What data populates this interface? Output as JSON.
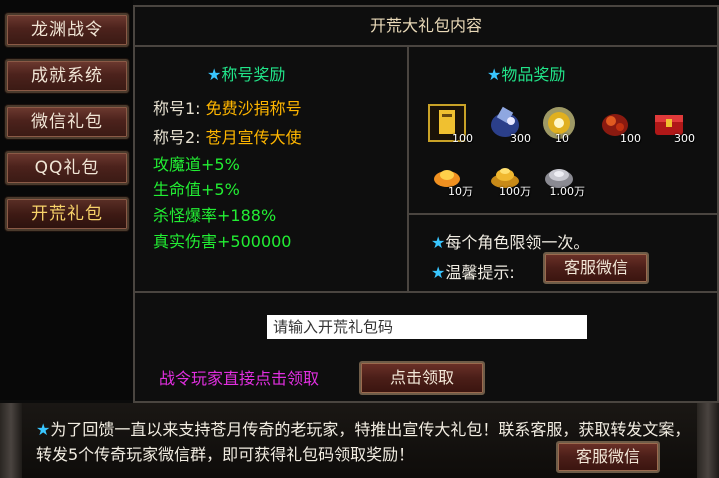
{
  "sidebar": {
    "tabs": [
      {
        "label": "龙渊战令"
      },
      {
        "label": "成就系统"
      },
      {
        "label": "微信礼包"
      },
      {
        "label": "QQ礼包"
      },
      {
        "label": "开荒礼包"
      }
    ],
    "active_index": 4
  },
  "panel": {
    "title": "开荒大礼包内容",
    "title_reward": {
      "heading": "称号奖励",
      "lines": [
        {
          "key": "称号1:",
          "value": "免费沙捐称号"
        },
        {
          "key": "称号2:",
          "value": "苍月宣传大使"
        }
      ],
      "stats": [
        "攻魔道+5%",
        "生命值+5%",
        "杀怪爆率+188%",
        "真实伤害+500000"
      ]
    },
    "item_reward": {
      "heading": "物品奖励",
      "items": [
        {
          "icon": "gold-scroll-icon",
          "qty": "100"
        },
        {
          "icon": "blue-bottle-icon",
          "qty": "300"
        },
        {
          "icon": "gold-orb-icon",
          "qty": "10"
        },
        {
          "icon": "red-bag-icon",
          "qty": "100"
        },
        {
          "icon": "red-treasure-box-icon",
          "qty": "300"
        },
        {
          "icon": "gold-ingot-icon",
          "qty": "10万"
        },
        {
          "icon": "gold-pile-icon",
          "qty": "100万"
        },
        {
          "icon": "silver-coin-icon",
          "qty": "1.00万"
        }
      ]
    },
    "notes": {
      "limit": "每个角色限领一次。",
      "tip": "温馨提示:",
      "service_button": "客服微信"
    },
    "code_input": {
      "placeholder": "请输入开荒礼包码"
    },
    "claim_hint": "战令玩家直接点击领取",
    "claim_button": "点击领取"
  },
  "footer": {
    "text": "为了回馈一直以来支持苍月传奇的老玩家，特推出宣传大礼包！联系客服，获取转发文案，转发5个传奇玩家微信群，即可获得礼包码领取奖励！",
    "service_button": "客服微信"
  },
  "colors": {
    "accent_green": "#22e58a",
    "star_blue": "#39c6ff",
    "gold": "#ffb600",
    "stat_green": "#22ee33",
    "purple": "#e12fe0"
  }
}
